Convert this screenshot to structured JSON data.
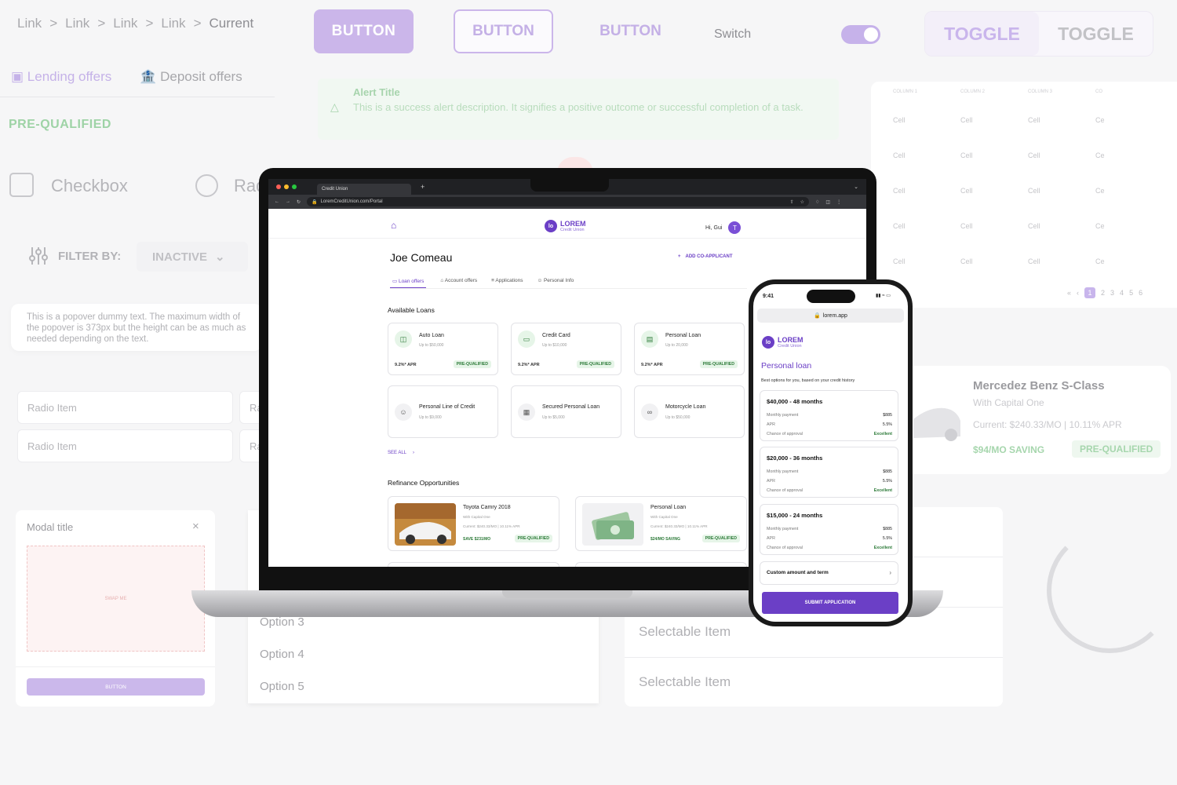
{
  "kit": {
    "breadcrumbs": [
      "Link",
      "Link",
      "Link",
      "Link"
    ],
    "breadcrumb_current": "Current",
    "breadcrumb_separator": ">",
    "button_filled": "BUTTON",
    "button_outlined": "BUTTON",
    "button_text": "BUTTON",
    "switch_label": "Switch",
    "toggle_1": "TOGGLE",
    "toggle_2": "TOGGLE",
    "tab_lending": "Lending offers",
    "tab_deposit": "Deposit offers",
    "prequalified": "PRE-QUALIFIED",
    "checkbox_label": "Checkbox",
    "radio_label": "Rad",
    "filter_label": "FILTER BY:",
    "filter_value": "INACTIVE",
    "popover_text": "This is a popover dummy text. The maximum width of the popover is 373px but the height can be as much as needed depending on the text.",
    "radio_items": [
      "Radio Item",
      "Radio Item"
    ],
    "radio_items_right": [
      "Ra",
      "Ra"
    ],
    "alert_title": "Alert Title",
    "alert_desc": "This is a success alert description. It signifies a positive outcome or successful completion of a task.",
    "table_headers": [
      "COLUMN 1",
      "COLUMN 2",
      "COLUMN 3",
      "CO"
    ],
    "table_cell": "Cell",
    "table_cell_cut": "Ce",
    "pager": [
      "1",
      "2",
      "3",
      "4",
      "5",
      "6"
    ],
    "car_title": "Mercedez Benz S-Class",
    "car_sub": "With Capital One",
    "car_current": "Current: $240.33/MO | 10.11% APR",
    "car_saving": "$94/MO SAVING",
    "car_preq": "PRE-QUALIFIED",
    "modal_title": "Modal title",
    "modal_swap": "SWAP ME",
    "modal_button": "BUTTON",
    "options": [
      "Option 3",
      "Option 4",
      "Option 5"
    ],
    "selectable": [
      "Selectable Item",
      "Selectable Item"
    ]
  },
  "browser": {
    "tab_title": "Credit Union",
    "url": "LoremCreditUnion.com/Portal"
  },
  "portal": {
    "logo": "LOREM",
    "logo_sub": "Credit Union",
    "greeting": "Hi, Gui",
    "avatar_letter": "T",
    "user_name": "Joe Comeau",
    "add_coapplicant": "ADD CO-APPLICANT",
    "tabs": [
      "Loan offers",
      "Account offers",
      "Applications",
      "Personal Info"
    ],
    "available_title": "Available Loans",
    "loans": [
      {
        "name": "Auto Loan",
        "up": "Up to $50,000",
        "apr": "9.2%* APR",
        "badge": "PRE-QUALIFIED",
        "icon": "car-icon"
      },
      {
        "name": "Credit Card",
        "up": "Up to $10,000",
        "apr": "9.2%* APR",
        "badge": "PRE-QUALIFIED",
        "icon": "credit-card-icon"
      },
      {
        "name": "Personal Loan",
        "up": "Up to 20,000",
        "apr": "9.2%* APR",
        "badge": "PRE-QUALIFIED",
        "icon": "cash-icon"
      },
      {
        "name": "Personal Line of Credit",
        "up": "Up to $9,000",
        "icon": "person-icon"
      },
      {
        "name": "Secured Personal Loan",
        "up": "Up to $5,000",
        "icon": "image-icon"
      },
      {
        "name": "Motorcycle Loan",
        "up": "Up to $50,000",
        "icon": "motorcycle-icon"
      }
    ],
    "see_all": "SEE ALL",
    "refi_title": "Refinance Opportunities",
    "refi": [
      {
        "title": "Toyota Camry 2018",
        "sub": "With Capital One",
        "current": "Current: $240.33/MO | 10.11% APR",
        "saving": "SAVE $231/MO",
        "badge": "PRE-QUALIFIED"
      },
      {
        "title": "Personal Loan",
        "sub": "With Capital One",
        "current": "Current: $240.33/MO | 10.11% APR",
        "saving": "$24/MO SAVING",
        "badge": "PRE-QUALIFIED"
      }
    ]
  },
  "phone": {
    "time": "9:41",
    "url": "lorem.app",
    "logo": "LOREM",
    "logo_sub": "Credit Union",
    "title": "Personal loan",
    "subtitle": "Best options for you, based on your credit history",
    "offers": [
      {
        "head": "$40,000 - 48 months",
        "payment": "$885",
        "apr": "5.5%",
        "chance": "Excellent"
      },
      {
        "head": "$20,000 - 36 months",
        "payment": "$885",
        "apr": "5.5%",
        "chance": "Excellent"
      },
      {
        "head": "$15,000 - 24 months",
        "payment": "$885",
        "apr": "5.5%",
        "chance": "Excellent"
      }
    ],
    "label_payment": "Monthly payment",
    "label_apr": "APR",
    "label_chance": "Chance of approval",
    "custom": "Custom amount and term",
    "submit": "SUBMIT APPLICATION"
  },
  "colors": {
    "brand": "#6b3fc6",
    "success": "#2c7a38",
    "kit_purple": "#cbb6ea"
  }
}
